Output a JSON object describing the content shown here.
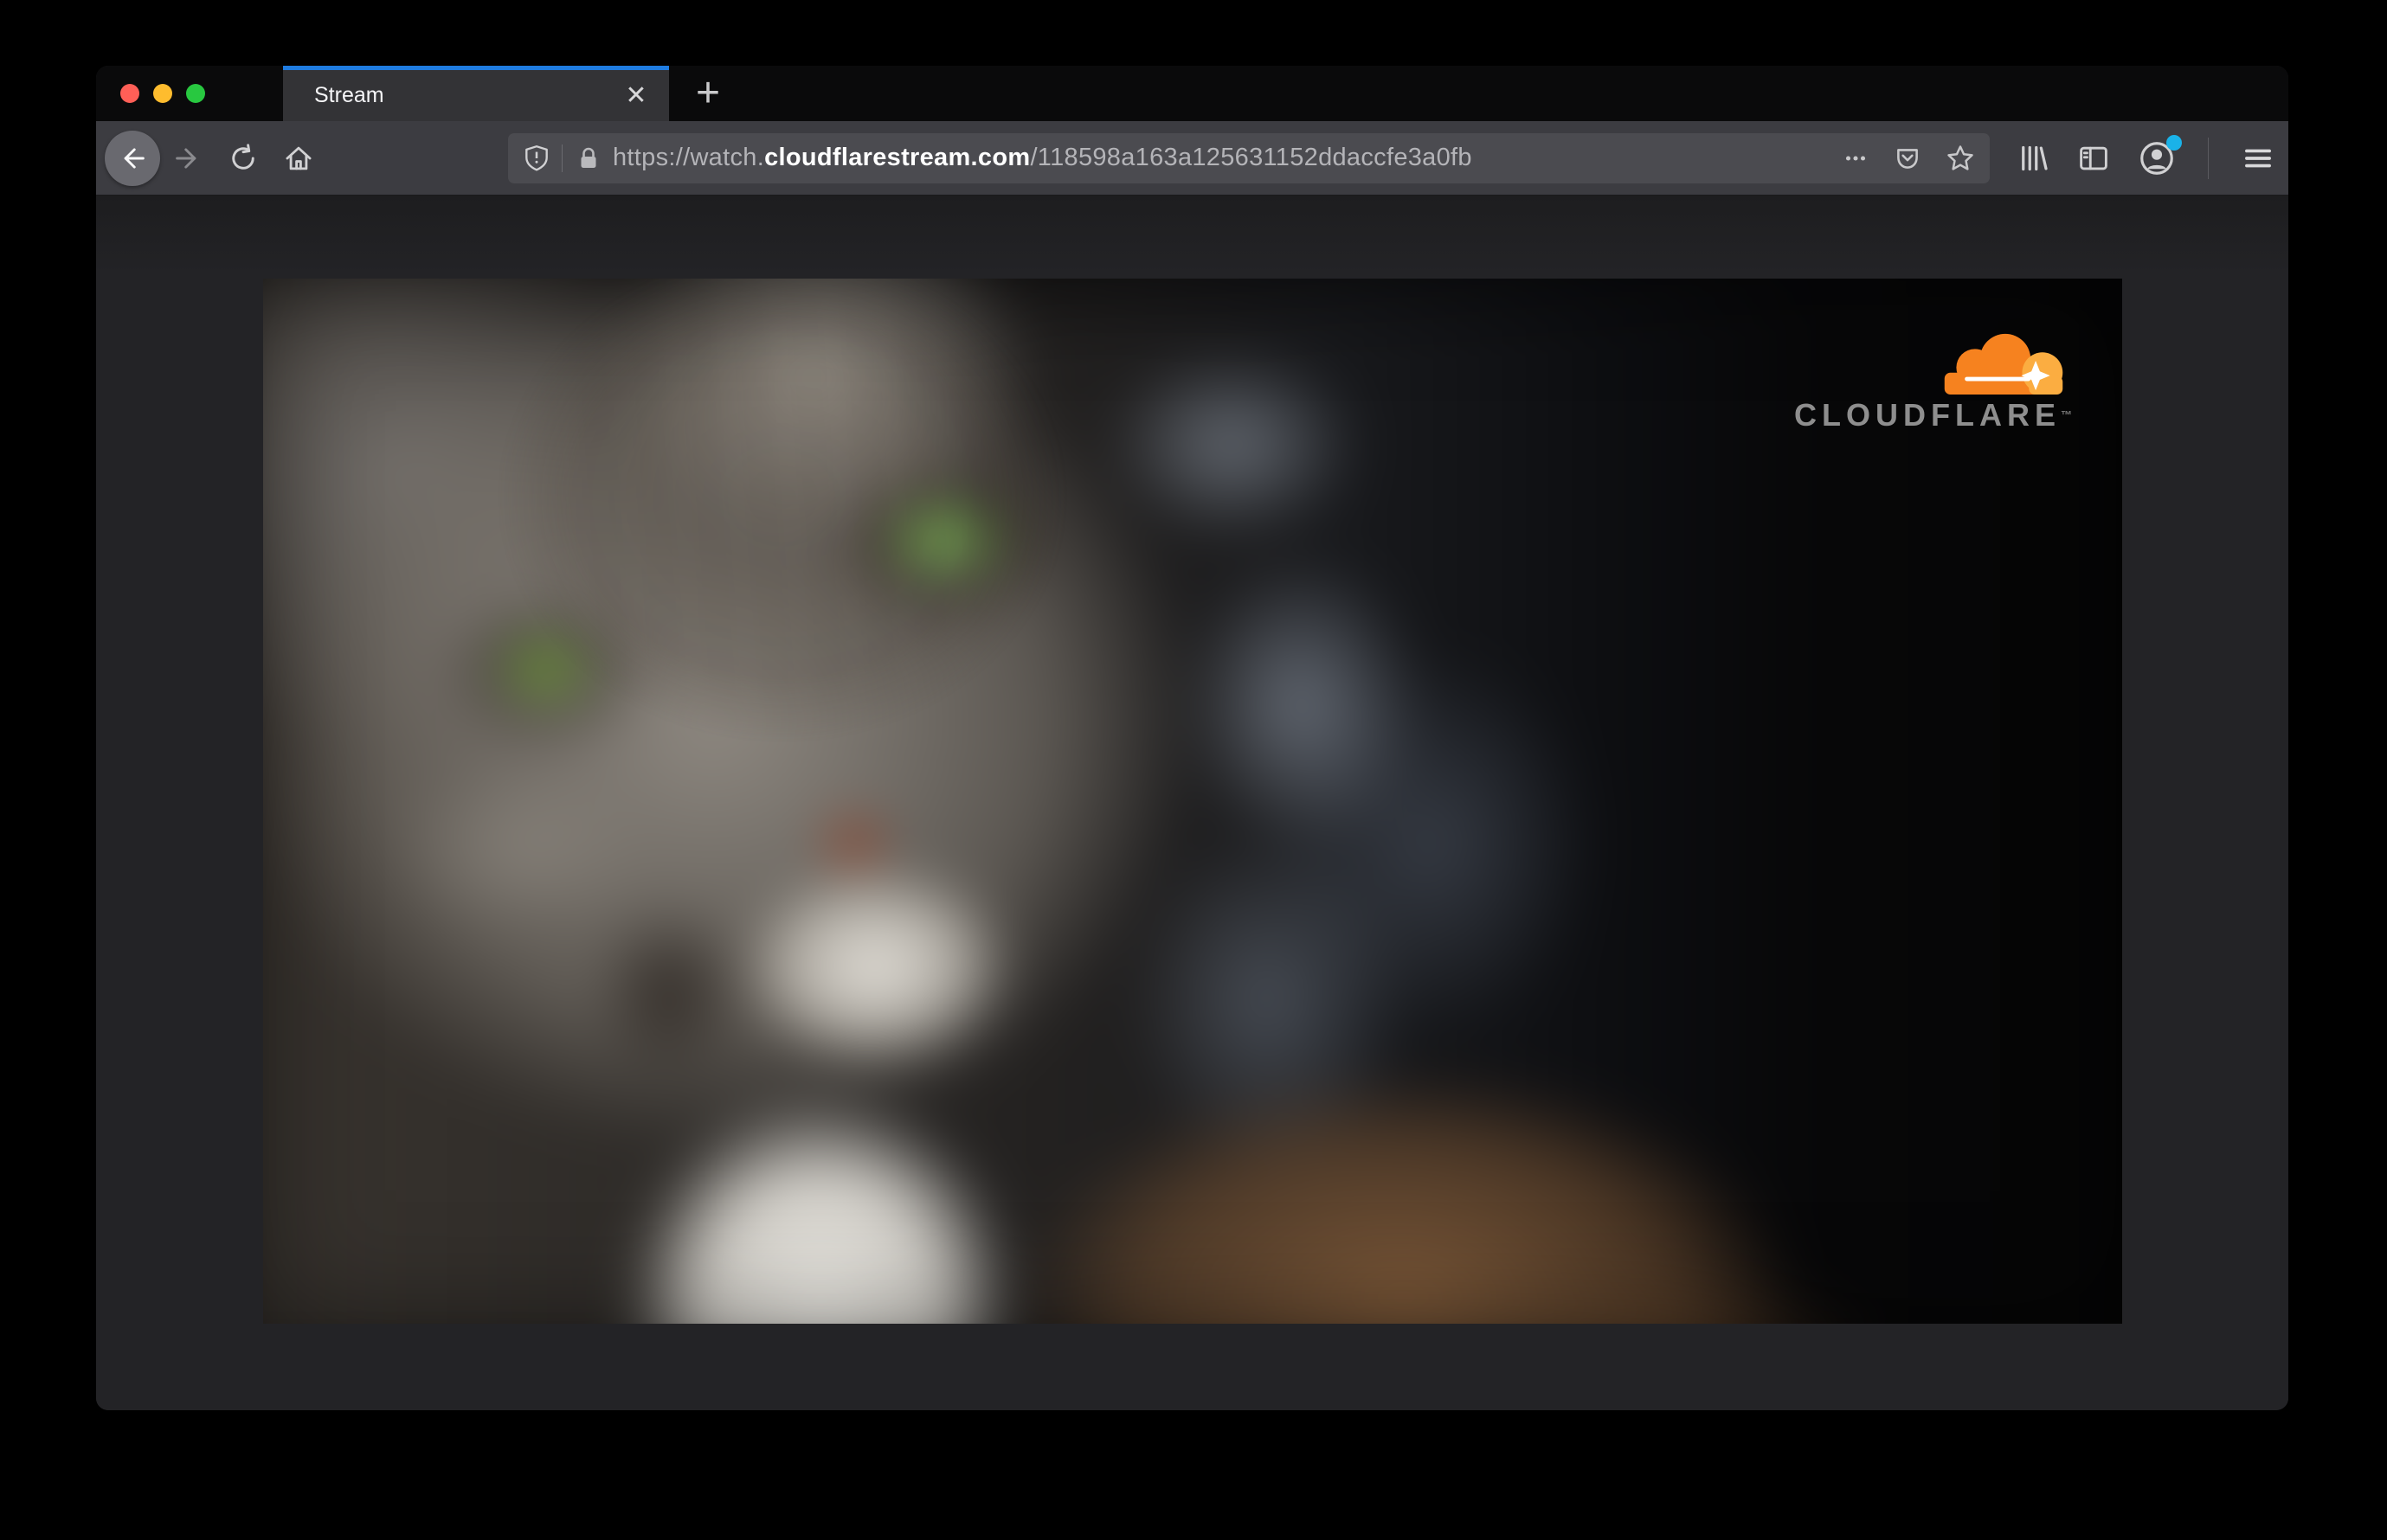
{
  "browser": {
    "traffic_lights": {
      "close_color": "#ff5f57",
      "minimize_color": "#febc2e",
      "zoom_color": "#28c840"
    },
    "tab": {
      "title": "Stream",
      "close_glyph": "✕",
      "active_stripe_color": "#1f7ce0"
    },
    "new_tab_glyph": "+",
    "urlbar": {
      "scheme_and_subdomain": "https://watch.",
      "domain": "cloudflarestream.com",
      "path": "/118598a163a125631152ddaccfe3a0fb"
    }
  },
  "video": {
    "brand_wordmark": "CLOUDFLARE",
    "brand_trademark": "™",
    "brand_colors": {
      "cloud_primary": "#f6821f",
      "cloud_light": "#fbad41"
    }
  }
}
